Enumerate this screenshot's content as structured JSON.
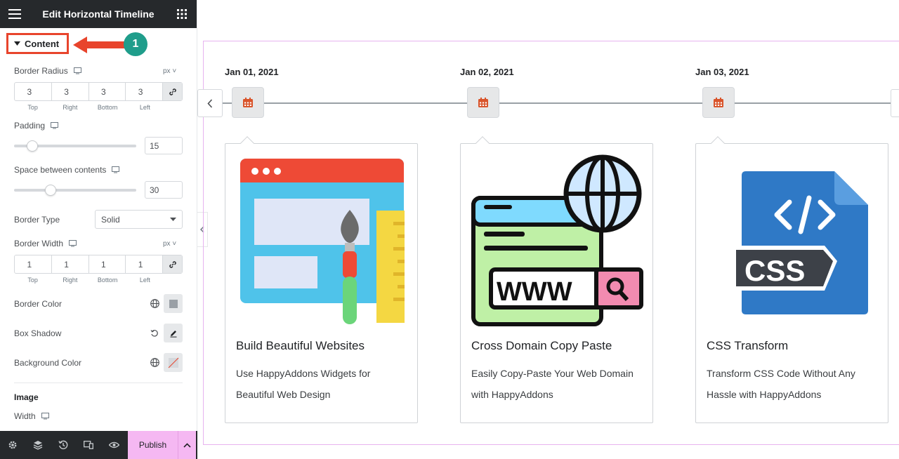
{
  "panel": {
    "title": "Edit Horizontal Timeline",
    "section_label": "Content",
    "callout_number": "1",
    "border_radius": {
      "label": "Border Radius",
      "unit": "px",
      "values": [
        "3",
        "3",
        "3",
        "3"
      ],
      "sides": [
        "Top",
        "Right",
        "Bottom",
        "Left"
      ]
    },
    "padding": {
      "label": "Padding",
      "value": "15",
      "slider_fraction": 0.15
    },
    "space_between": {
      "label": "Space between contents",
      "value": "30",
      "slider_fraction": 0.3
    },
    "border_type": {
      "label": "Border Type",
      "value": "Solid"
    },
    "border_width": {
      "label": "Border Width",
      "unit": "px",
      "values": [
        "1",
        "1",
        "1",
        "1"
      ],
      "sides": [
        "Top",
        "Right",
        "Bottom",
        "Left"
      ]
    },
    "border_color": {
      "label": "Border Color"
    },
    "box_shadow": {
      "label": "Box Shadow"
    },
    "background_color": {
      "label": "Background Color"
    },
    "image_heading": "Image",
    "width_label": "Width",
    "footer": {
      "publish_label": "Publish"
    }
  },
  "timeline": {
    "items": [
      {
        "date": "Jan 01, 2021",
        "title": "Build Beautiful Websites",
        "description": "Use HappyAddons Widgets for Beautiful Web Design",
        "image": "website-design-illustration"
      },
      {
        "date": "Jan 02, 2021",
        "title": "Cross Domain Copy Paste",
        "description": "Easily Copy-Paste Your Web Domain with HappyAddons",
        "image": "www-globe-illustration"
      },
      {
        "date": "Jan 03, 2021",
        "title": "CSS Transform",
        "description": "Transform CSS Code Without Any Hassle with HappyAddons",
        "image": "css-file-illustration"
      }
    ]
  },
  "colors": {
    "panel_header": "#26292c",
    "highlight_red": "#e8442c",
    "callout_teal": "#1f9d8b",
    "publish_pink": "#f5b8f2",
    "canvas_border": "#e7b3ef",
    "calendar_icon": "#d9552c"
  }
}
